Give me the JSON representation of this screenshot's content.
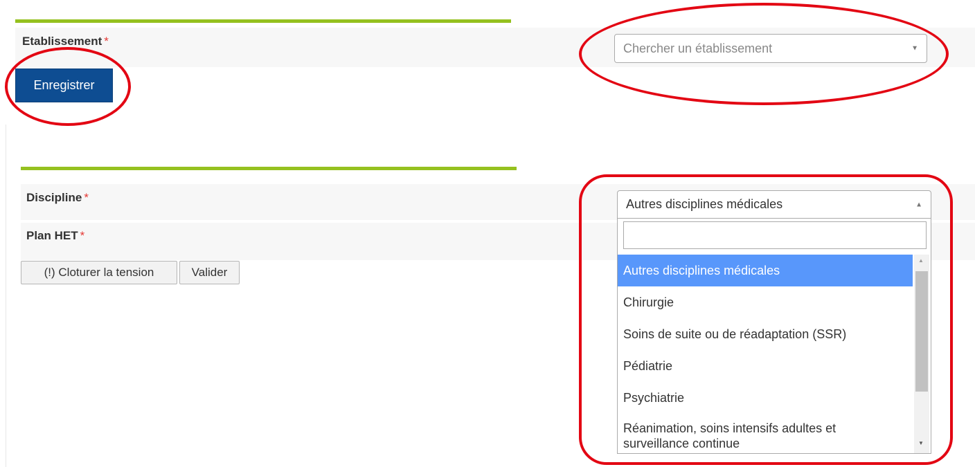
{
  "section1": {
    "field_label": "Etablissement",
    "required_mark": "*",
    "select_placeholder": "Chercher un établissement",
    "save_button": "Enregistrer"
  },
  "section2": {
    "discipline_label": "Discipline",
    "plan_label": "Plan HET",
    "required_mark": "*",
    "close_tension_button": "(!) Cloturer la tension",
    "validate_button": "Valider",
    "discipline_select": {
      "selected_value": "Autres disciplines médicales",
      "search_value": "",
      "options": [
        {
          "label": "Autres disciplines médicales",
          "highlighted": true
        },
        {
          "label": "Chirurgie",
          "highlighted": false
        },
        {
          "label": "Soins de suite ou de réadaptation (SSR)",
          "highlighted": false
        },
        {
          "label": "Pédiatrie",
          "highlighted": false
        },
        {
          "label": "Psychiatrie",
          "highlighted": false
        },
        {
          "label": "Réanimation, soins intensifs adultes et surveillance continue",
          "highlighted": false
        }
      ]
    }
  },
  "colors": {
    "accent_rule": "#95c11f",
    "primary_button": "#0e4d92",
    "highlight_option": "#5897fb",
    "annotation_circle": "#e30613",
    "required_star": "#e53935"
  }
}
